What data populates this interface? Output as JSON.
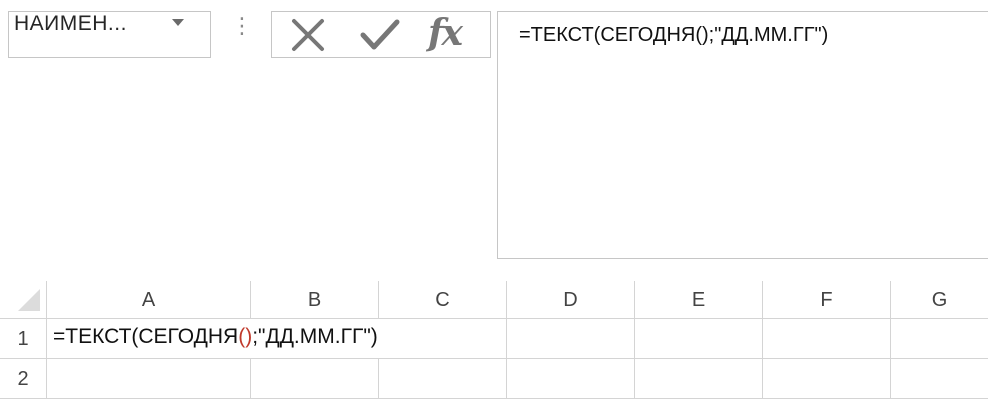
{
  "name_box": {
    "value": "НАИМЕН..."
  },
  "toolbar": {
    "grip": "⋮"
  },
  "formula_bar": {
    "formula": "=ТЕКСТ(СЕГОДНЯ();\"ДД.ММ.ГГ\")"
  },
  "sheet": {
    "columns": [
      "A",
      "B",
      "C",
      "D",
      "E",
      "F",
      "G"
    ],
    "rows": [
      "1",
      "2"
    ],
    "cell_a1": {
      "part1": "=ТЕКСТ(СЕГОДНЯ",
      "open_paren": "(",
      "close_paren": ")",
      "part2": ";\"ДД.ММ.ГГ\")"
    }
  },
  "colors": {
    "grid_line": "#d4d4d4",
    "paren_highlight": "#c0392b",
    "icon_gray": "#777777"
  }
}
